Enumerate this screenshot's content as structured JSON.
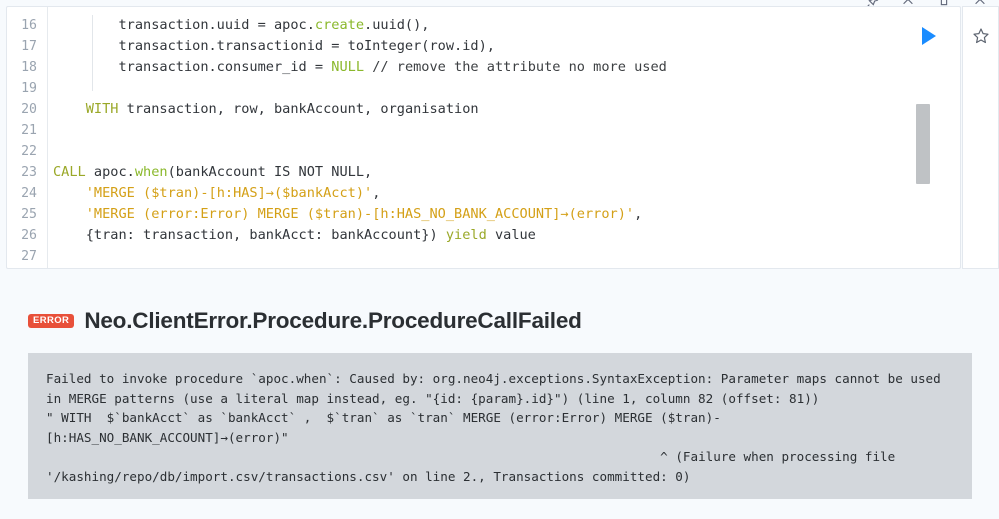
{
  "window": {
    "chrome_icons": [
      "pin-icon",
      "chevron-up-icon",
      "minimize-icon",
      "chevron-down-icon"
    ]
  },
  "editor": {
    "run_button_label": "Run",
    "favorite_button_label": "Add to favorites",
    "first_visible_line": 16,
    "lines": [
      {
        "num": "16",
        "segments": [
          {
            "t": "        transaction.uuid = apoc.",
            "c": "tk-pl"
          },
          {
            "t": "create",
            "c": "tk-fn"
          },
          {
            "t": ".uuid(),",
            "c": "tk-pl"
          }
        ]
      },
      {
        "num": "17",
        "segments": [
          {
            "t": "        transaction.transactionid = toInteger(row.id),",
            "c": "tk-pl"
          }
        ]
      },
      {
        "num": "18",
        "segments": [
          {
            "t": "        transaction.consumer_id = ",
            "c": "tk-pl"
          },
          {
            "t": "NULL",
            "c": "tk-null"
          },
          {
            "t": " ",
            "c": "tk-pl"
          },
          {
            "t": "// remove the attribute no more used",
            "c": "tk-cmt"
          }
        ]
      },
      {
        "num": "19",
        "segments": [
          {
            "t": "",
            "c": "tk-pl"
          }
        ]
      },
      {
        "num": "20",
        "segments": [
          {
            "t": "    ",
            "c": "tk-pl"
          },
          {
            "t": "WITH",
            "c": "tk-kw"
          },
          {
            "t": " transaction, row, bankAccount, organisation",
            "c": "tk-pl"
          }
        ]
      },
      {
        "num": "21",
        "segments": [
          {
            "t": "",
            "c": "tk-pl"
          }
        ]
      },
      {
        "num": "22",
        "segments": [
          {
            "t": "",
            "c": "tk-pl"
          }
        ]
      },
      {
        "num": "23",
        "segments": [
          {
            "t": "CALL",
            "c": "tk-kw"
          },
          {
            "t": " apoc.",
            "c": "tk-pl"
          },
          {
            "t": "when",
            "c": "tk-fn"
          },
          {
            "t": "(bankAccount IS NOT NULL,",
            "c": "tk-pl"
          }
        ]
      },
      {
        "num": "24",
        "segments": [
          {
            "t": "    ",
            "c": "tk-pl"
          },
          {
            "t": "'MERGE ($tran)-[h:HAS]→($bankAcct)'",
            "c": "tk-str"
          },
          {
            "t": ",",
            "c": "tk-pl"
          }
        ]
      },
      {
        "num": "25",
        "segments": [
          {
            "t": "    ",
            "c": "tk-pl"
          },
          {
            "t": "'MERGE (error:Error) MERGE ($tran)-[h:HAS_NO_BANK_ACCOUNT]→(error)'",
            "c": "tk-str"
          },
          {
            "t": ",",
            "c": "tk-pl"
          }
        ]
      },
      {
        "num": "26",
        "segments": [
          {
            "t": "    {tran: transaction, bankAcct: bankAccount}) ",
            "c": "tk-pl"
          },
          {
            "t": "yield",
            "c": "tk-kw"
          },
          {
            "t": " value",
            "c": "tk-pl"
          }
        ]
      },
      {
        "num": "27",
        "segments": [
          {
            "t": "",
            "c": "tk-pl"
          }
        ]
      }
    ]
  },
  "error": {
    "badge": "ERROR",
    "title": "Neo.ClientError.Procedure.ProcedureCallFailed",
    "message": "Failed to invoke procedure `apoc.when`: Caused by: org.neo4j.exceptions.SyntaxException: Parameter maps cannot be used in MERGE patterns (use a literal map instead, eg. \"{id: {param}.id}\") (line 1, column 82 (offset: 81))\n\" WITH  $`bankAcct` as `bankAcct` ,  $`tran` as `tran` MERGE (error:Error) MERGE ($tran)-[h:HAS_NO_BANK_ACCOUNT]→(error)\"\n                                                                                 ^ (Failure when processing file '/kashing/repo/db/import.csv/transactions.csv' on line 2., Transactions committed: 0)"
  },
  "colors": {
    "accent_blue": "#1a8cff",
    "error_red": "#e8503a",
    "error_panel_bg": "#d3d7dc",
    "page_bg": "#f7fafd",
    "keyword": "#9aa828",
    "string": "#d4a017"
  }
}
